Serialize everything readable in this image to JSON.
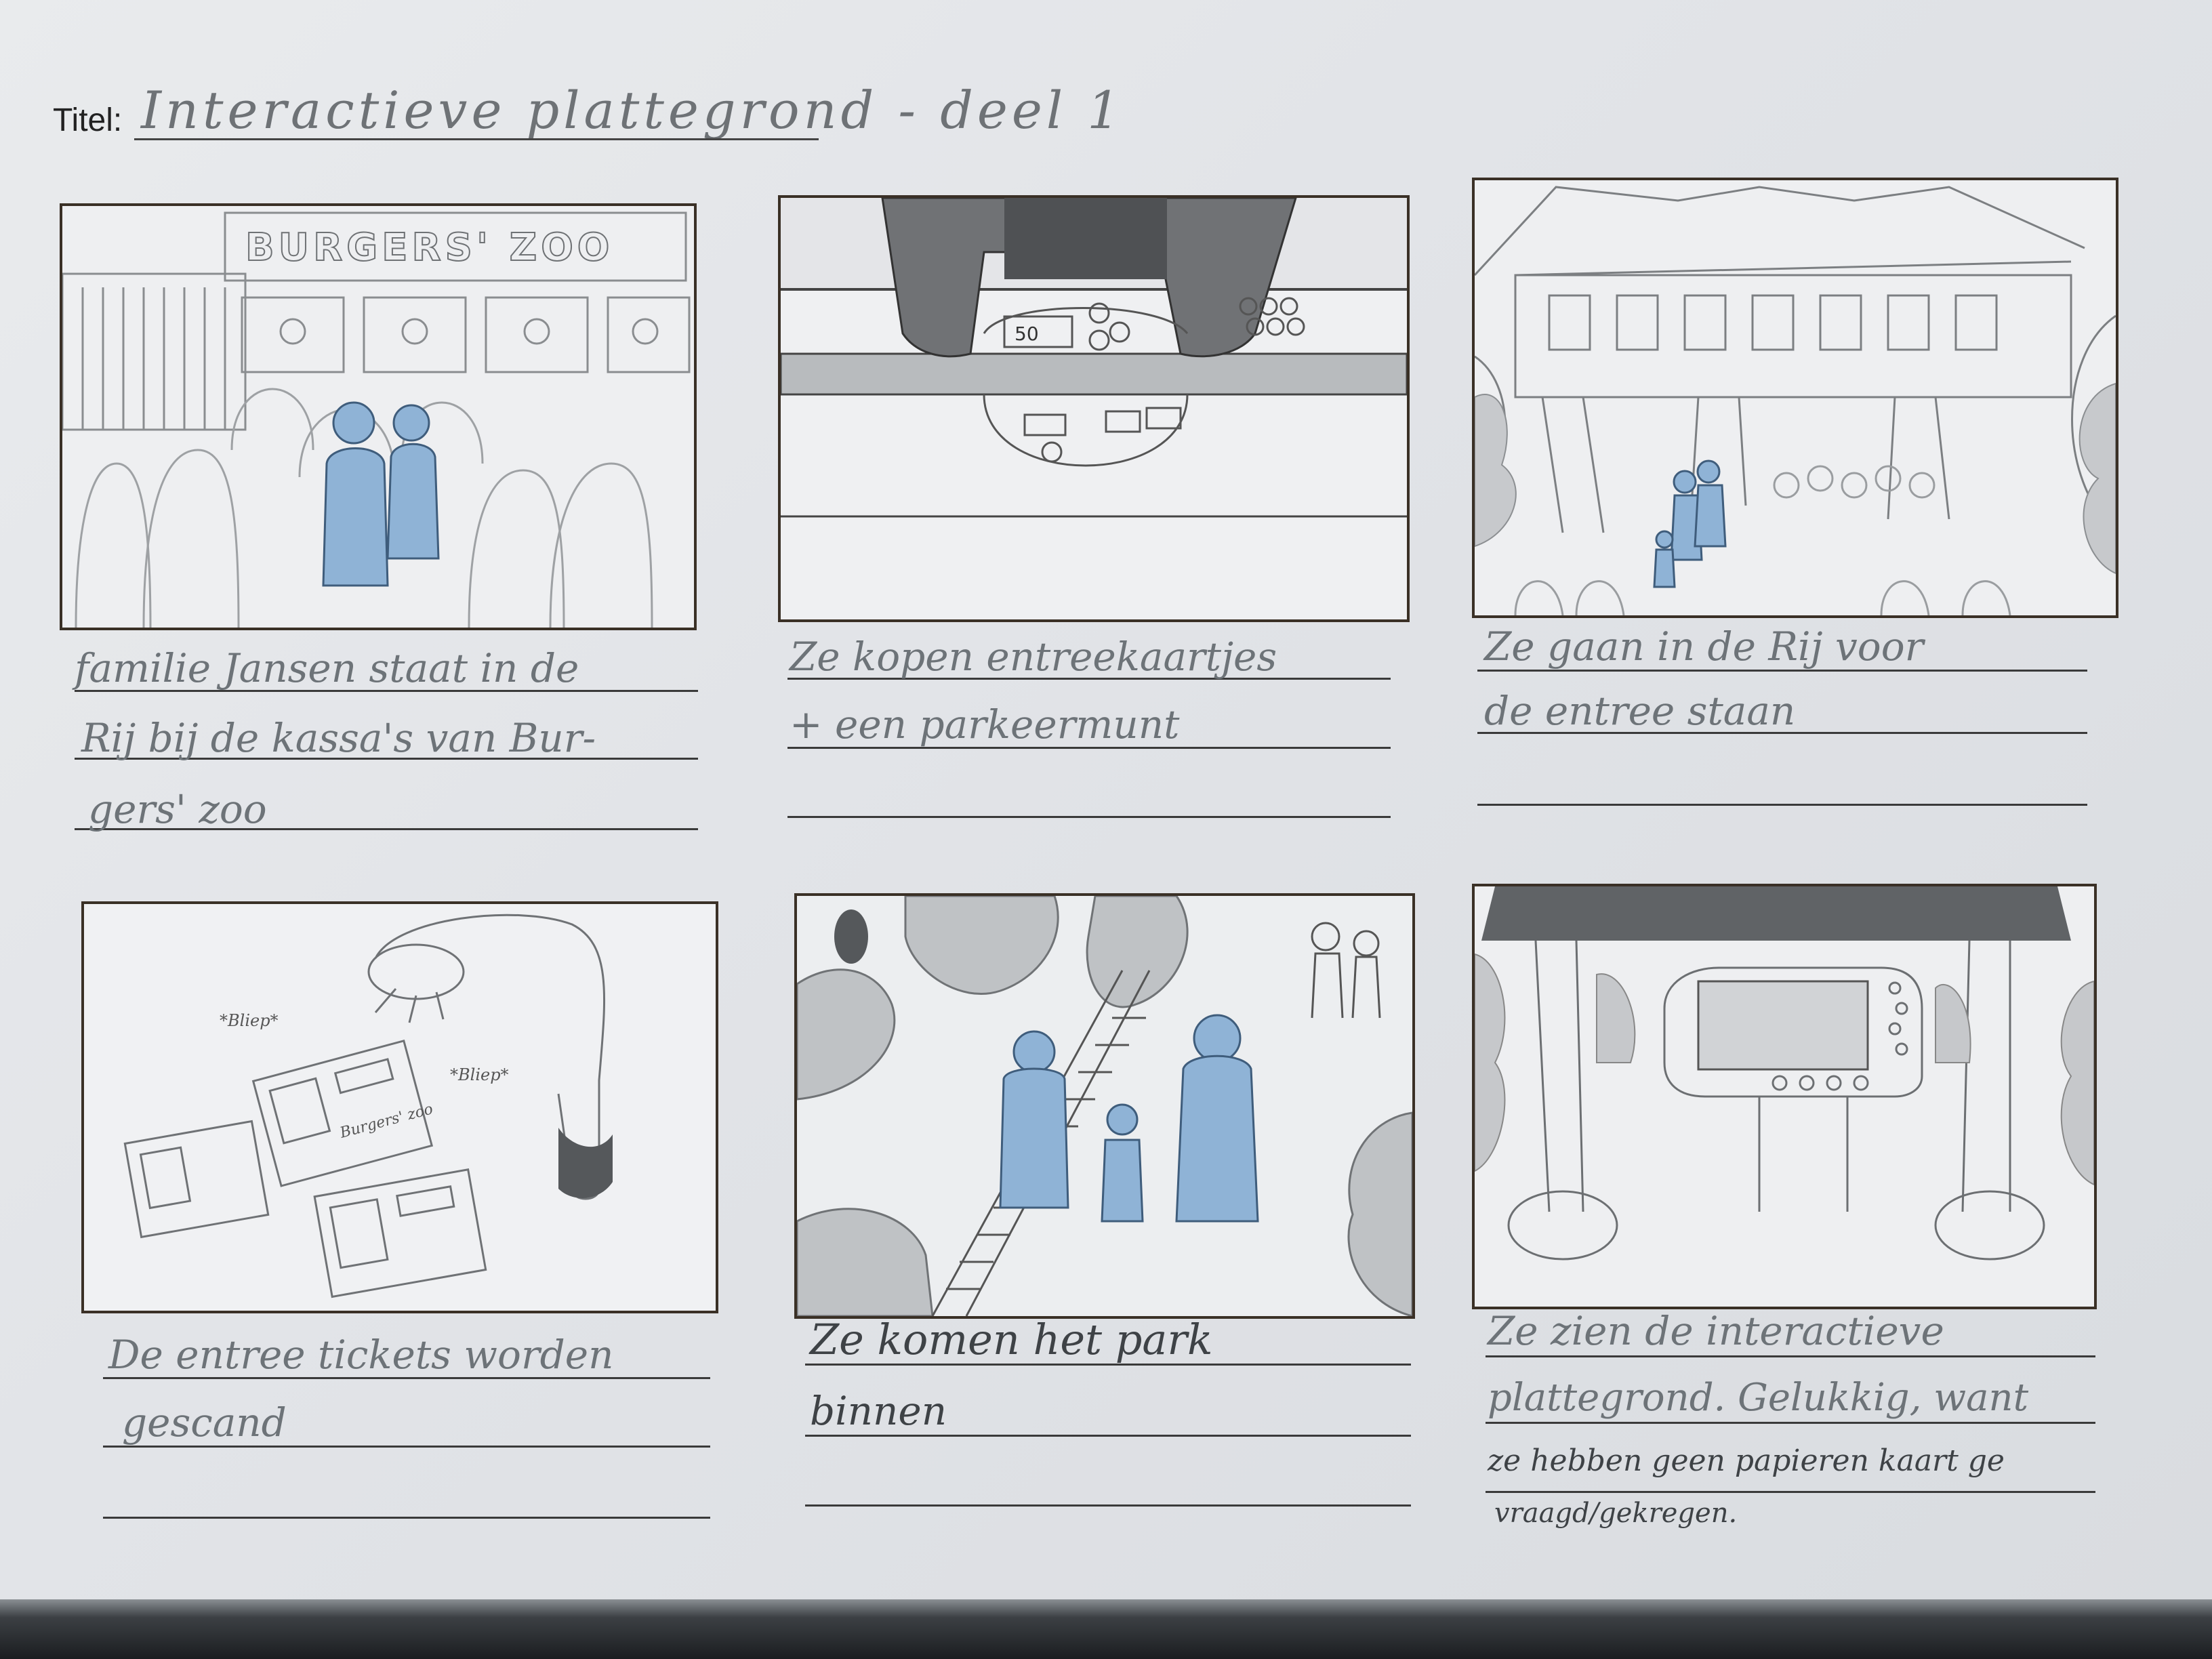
{
  "title": {
    "label": "Titel:",
    "value": "Interactieve plattegrond - deel 1"
  },
  "panels": [
    {
      "id": 1,
      "sign": "BURGERS' ZOO",
      "caption": [
        "familie Jansen staat in de",
        "Rij bij de kassa's van Bur-",
        "gers' zoo"
      ]
    },
    {
      "id": 2,
      "money_label": "50",
      "caption": [
        "Ze kopen entreekaartjes",
        "+ een parkeermunt"
      ]
    },
    {
      "id": 3,
      "caption": [
        "Ze gaan in de Rij voor",
        "de entree staan"
      ]
    },
    {
      "id": 4,
      "sounds": [
        "*Bliep*",
        "*Bliep*"
      ],
      "ticket_label": "Burgers' zoo",
      "caption": [
        "De entree tickets worden",
        "gescand"
      ]
    },
    {
      "id": 5,
      "caption": [
        "Ze komen het park",
        "binnen"
      ]
    },
    {
      "id": 6,
      "caption": [
        "Ze zien de interactieve",
        "plattegrond. Gelukkig, want",
        "ze hebben geen papieren kaart ge",
        "vraagd/gekregen."
      ]
    }
  ]
}
